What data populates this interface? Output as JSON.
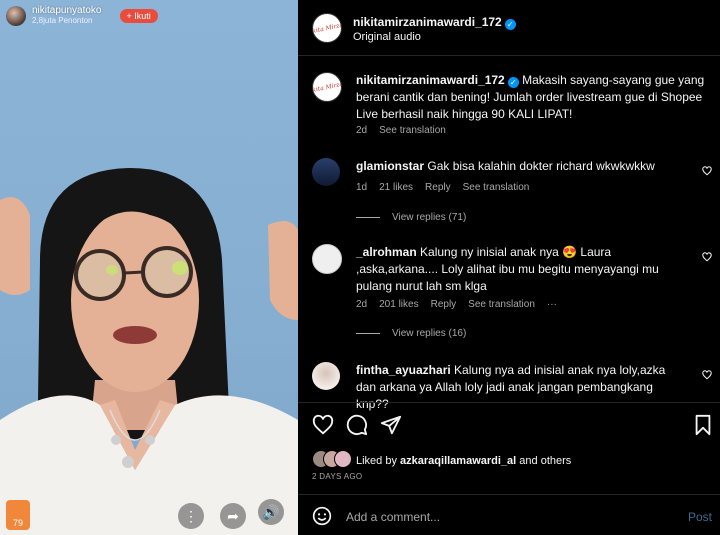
{
  "video": {
    "username": "nikitapunyatoko",
    "viewers": "2,8juta Penonton",
    "follow_label": "+ Ikuti",
    "shop_badge": "79",
    "controls": [
      "more-icon",
      "share-icon",
      "volume-icon"
    ]
  },
  "header": {
    "username": "nikitamirzanimawardi_172",
    "subtitle": "Original audio",
    "logo_text": "Nikita Mirzani"
  },
  "caption": {
    "username": "nikitamirzanimawardi_172",
    "text": "Makasih sayang-sayang gue yang berani cantik dan bening! Jumlah order livestream gue di Shopee Live berhasil naik hingga 90 KALI LIPAT!",
    "time": "2d",
    "translate": "See translation"
  },
  "comments": [
    {
      "username": "glamionstar",
      "text": "Gak bisa kalahin dokter richard wkwkwkkw",
      "time": "1d",
      "likes": "21 likes",
      "reply": "Reply",
      "translate": "See translation",
      "view_replies": "View replies (71)"
    },
    {
      "username": "_alrohman",
      "text": "Kalung ny inisial anak nya 😍 Laura ,aska,arkana.... Loly alihat ibu mu begitu menyayangi mu pulang nurut lah sm klga",
      "time": "2d",
      "likes": "201 likes",
      "reply": "Reply",
      "translate": "See translation",
      "more": "···",
      "view_replies": "View replies (16)"
    },
    {
      "username": "fintha_ayuazhari",
      "text": "Kalung nya ad inisial anak nya loly,azka dan arkana ya Allah loly jadi anak jangan pembangkang knp??"
    }
  ],
  "likes": {
    "prefix": "Liked by",
    "user": "azkaraqillamawardi_al",
    "suffix": "and others"
  },
  "date": "2 DAYS AGO",
  "add_comment": {
    "placeholder": "Add a comment...",
    "post_label": "Post"
  },
  "colors": {
    "verified": "#0095f6",
    "follow": "#e94b3c",
    "post_button": "#3f6a8f"
  }
}
